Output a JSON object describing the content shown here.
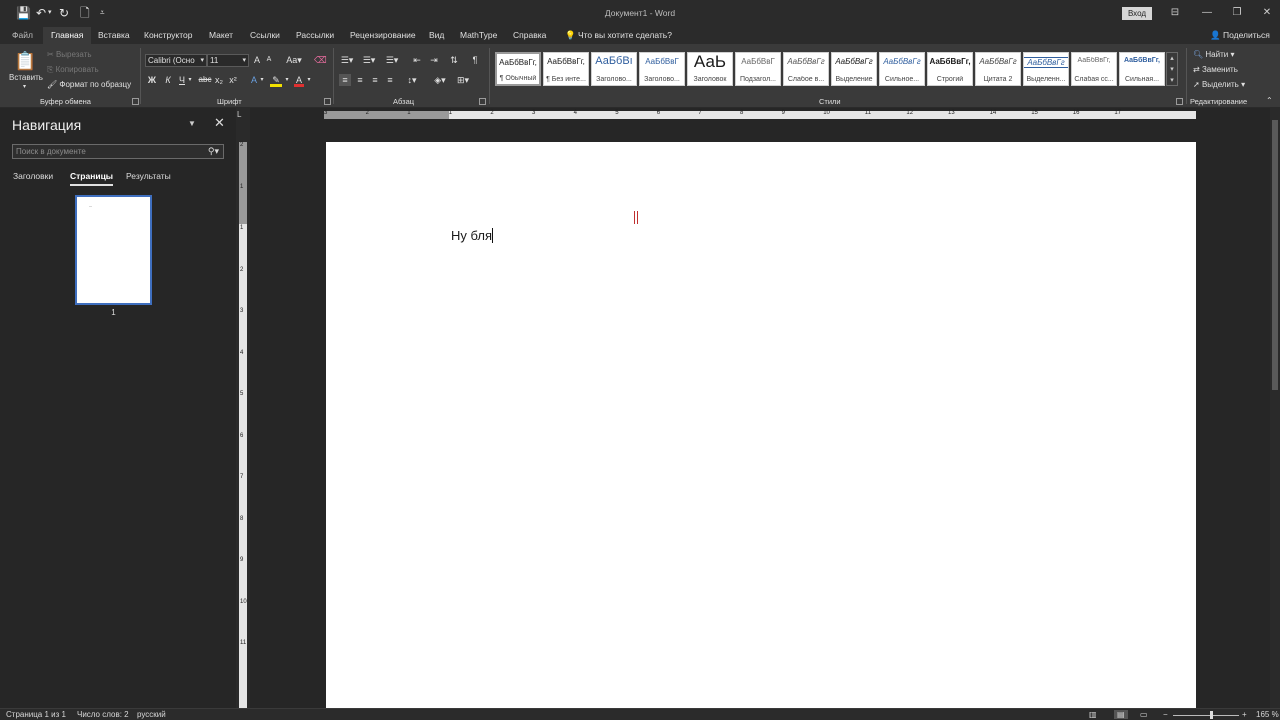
{
  "titlebar": {
    "doc_title": "Документ1 - Word",
    "signin_label": "Вход",
    "qa_icons": [
      "save-icon",
      "undo-icon",
      "redo-icon",
      "new-document-icon",
      "customize-qat-icon"
    ]
  },
  "tabs": {
    "items": [
      "Файл",
      "Главная",
      "Вставка",
      "Конструктор",
      "Макет",
      "Ссылки",
      "Рассылки",
      "Рецензирование",
      "Вид",
      "MathType",
      "Справка"
    ],
    "active": "Главная",
    "tell_me": "Что вы хотите сделать?",
    "share": "Поделиться"
  },
  "ribbon": {
    "clipboard": {
      "paste_label": "Вставить",
      "cut_label": "Вырезать",
      "copy_label": "Копировать",
      "format_painter_label": "Формат по образцу",
      "group_label": "Буфер обмена"
    },
    "font": {
      "font_name": "Calibri (Осно",
      "font_size": "11",
      "case_label": "Aa",
      "bold": "Ж",
      "italic": "К",
      "underline": "Ч",
      "strike": "abc",
      "subscript": "x₂",
      "superscript": "x²",
      "group_label": "Шрифт"
    },
    "paragraph": {
      "group_label": "Абзац"
    },
    "styles": {
      "group_label": "Стили",
      "items": [
        {
          "sample": "АаБбВвГг,",
          "name": "¶ Обычный"
        },
        {
          "sample": "АаБбВвГг,",
          "name": "¶ Без инте..."
        },
        {
          "sample": "АаБбВı",
          "name": "Заголово..."
        },
        {
          "sample": "АаБбВвГ",
          "name": "Заголово..."
        },
        {
          "sample": "АаЬ",
          "name": "Заголовок"
        },
        {
          "sample": "АаБбВвГ",
          "name": "Подзагол..."
        },
        {
          "sample": "АаБбВвГг",
          "name": "Слабое в..."
        },
        {
          "sample": "АаБбВвГг",
          "name": "Выделение"
        },
        {
          "sample": "АаБбВвГг",
          "name": "Сильное..."
        },
        {
          "sample": "АаБбВвГг,",
          "name": "Строгий"
        },
        {
          "sample": "АаБбВвГг",
          "name": "Цитата 2"
        },
        {
          "sample": "АаБбВвГг",
          "name": "Выделенн..."
        },
        {
          "sample": "АаБбВвГг,",
          "name": "Слабая сс..."
        },
        {
          "sample": "АаБбВвГг,",
          "name": "Сильная..."
        }
      ]
    },
    "editing": {
      "find_label": "Найти",
      "replace_label": "Заменить",
      "select_label": "Выделить",
      "group_label": "Редактирование"
    }
  },
  "navigation": {
    "title": "Навигация",
    "search_placeholder": "Поиск в документе",
    "tabs": [
      "Заголовки",
      "Страницы",
      "Результаты"
    ],
    "active_tab": "Страницы",
    "page_number": "1"
  },
  "document": {
    "text": "Ну бля"
  },
  "ruler": {
    "h_numbers": [
      "3",
      "2",
      "1",
      "1",
      "2",
      "3",
      "4",
      "5",
      "6",
      "7",
      "8",
      "9",
      "10",
      "11",
      "12",
      "13",
      "14",
      "15",
      "16",
      "17"
    ],
    "v_numbers": [
      "2",
      "1",
      "1",
      "2",
      "3",
      "4",
      "5",
      "6",
      "7",
      "8",
      "9",
      "10",
      "11"
    ]
  },
  "statusbar": {
    "page": "Страница 1 из 1",
    "words": "Число слов: 2",
    "language": "русский",
    "zoom": "165 %",
    "zoom_percent": 165
  },
  "colors": {
    "accent": "#3f6fbf",
    "ribbon_bg": "#3a3a3a",
    "title_bg": "#2b2b2b",
    "highlight_yellow": "#f2e100",
    "font_red": "#e03030"
  }
}
